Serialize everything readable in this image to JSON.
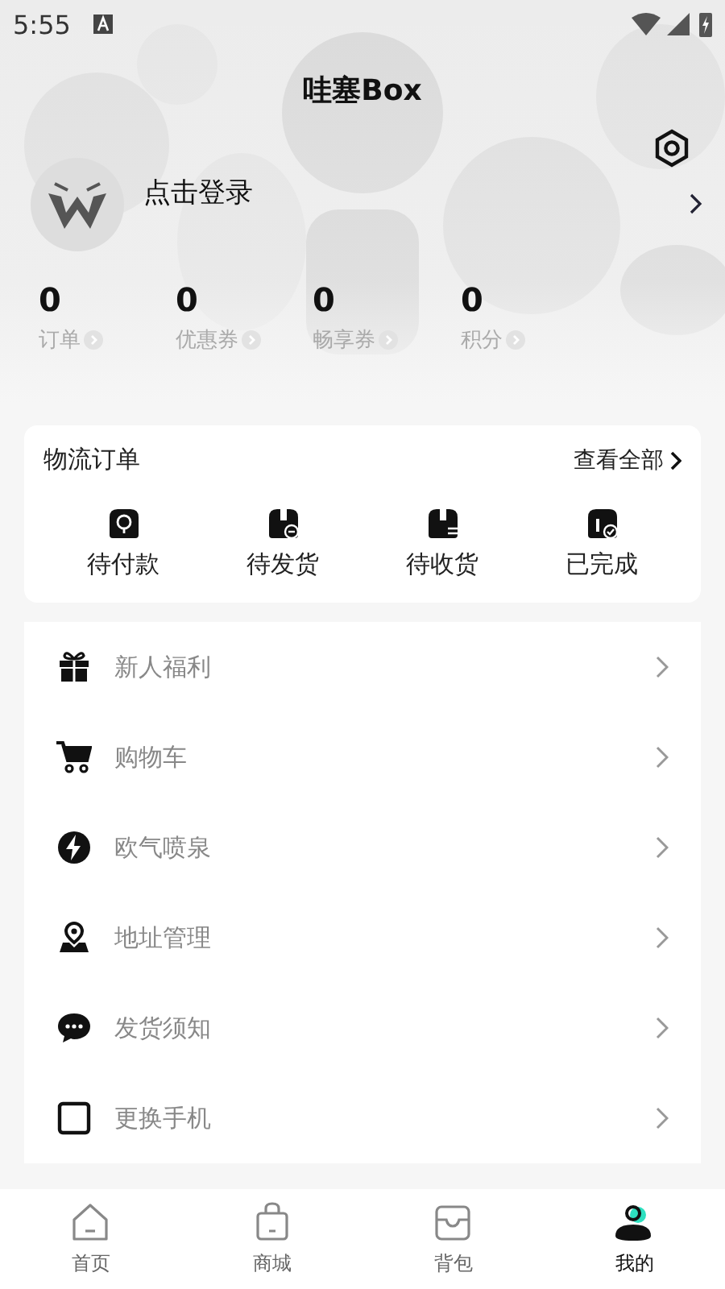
{
  "status_bar": {
    "time": "5:55"
  },
  "title": "哇塞Box",
  "profile": {
    "login_text": "点击登录"
  },
  "stats": [
    {
      "value": "0",
      "label": "订单"
    },
    {
      "value": "0",
      "label": "优惠券"
    },
    {
      "value": "0",
      "label": "畅享券"
    },
    {
      "value": "0",
      "label": "积分"
    }
  ],
  "orders": {
    "title": "物流订单",
    "view_all": "查看全部",
    "items": [
      {
        "kind": "pay",
        "label": "待付款"
      },
      {
        "kind": "ship",
        "label": "待发货"
      },
      {
        "kind": "receive",
        "label": "待收货"
      },
      {
        "kind": "done",
        "label": "已完成"
      }
    ]
  },
  "menu": [
    {
      "kind": "gift",
      "label": "新人福利"
    },
    {
      "kind": "cart",
      "label": "购物车"
    },
    {
      "kind": "bolt",
      "label": "欧气喷泉"
    },
    {
      "kind": "location",
      "label": "地址管理"
    },
    {
      "kind": "chat",
      "label": "发货须知"
    },
    {
      "kind": "phone",
      "label": "更换手机"
    }
  ],
  "tab_bar": [
    {
      "kind": "home",
      "label": "首页",
      "selected": false
    },
    {
      "kind": "shop",
      "label": "商城",
      "selected": false
    },
    {
      "kind": "bag",
      "label": "背包",
      "selected": false
    },
    {
      "kind": "me",
      "label": "我的",
      "selected": true
    }
  ]
}
